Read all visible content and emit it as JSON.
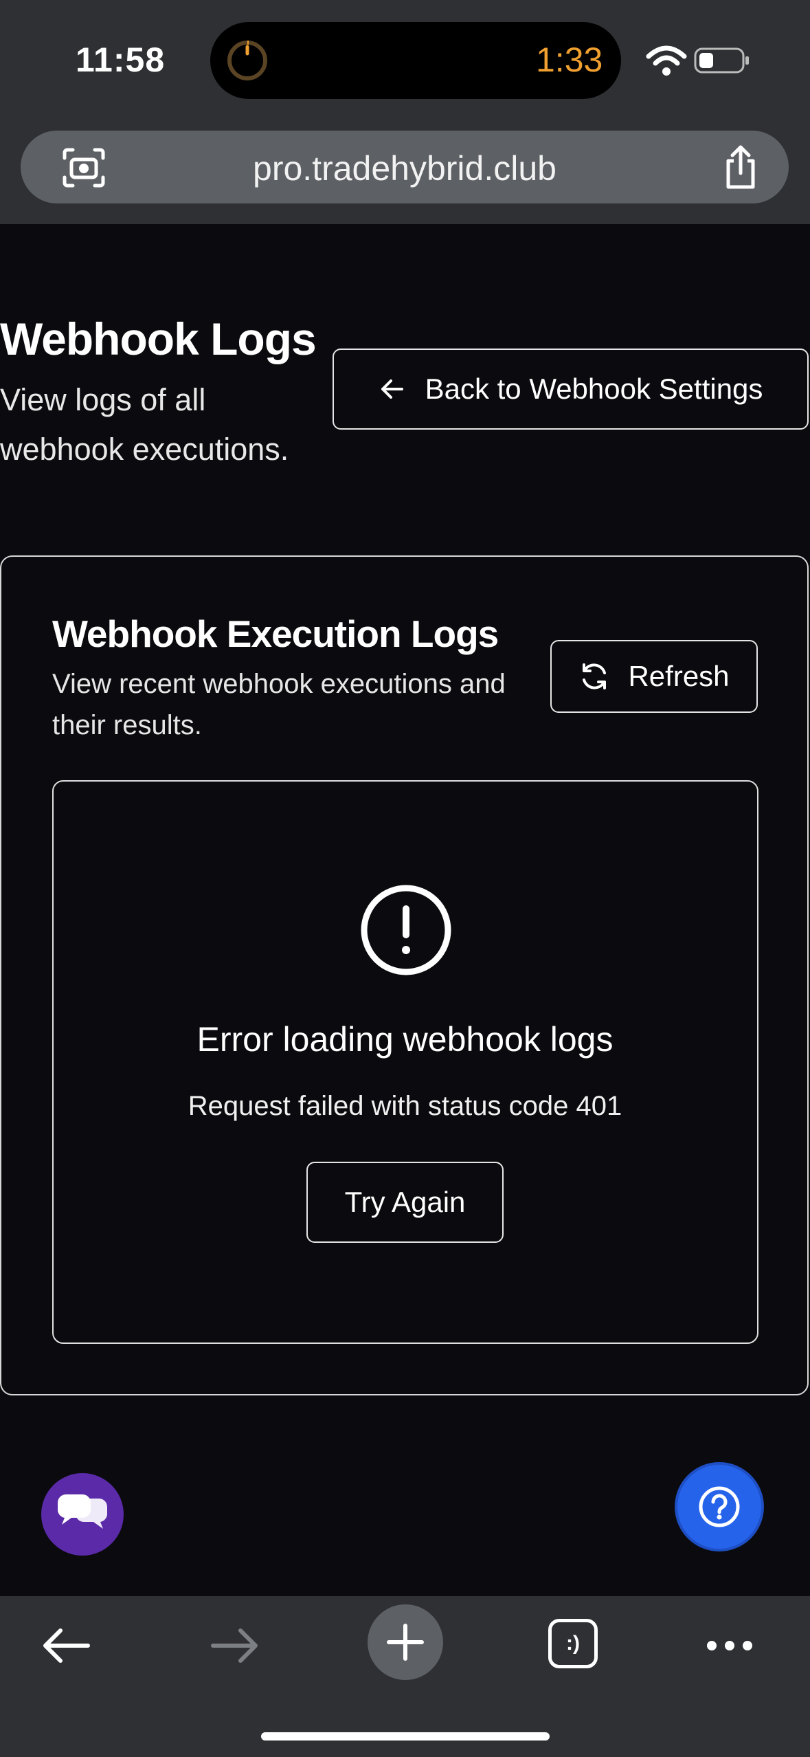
{
  "status_bar": {
    "time": "11:58",
    "timer": "1:33"
  },
  "browser": {
    "url": "pro.tradehybrid.club"
  },
  "page": {
    "title": "Webhook Logs",
    "subtitle": "View logs of all webhook executions.",
    "back_button": "Back to Webhook Settings"
  },
  "card": {
    "title": "Webhook Execution Logs",
    "subtitle": "View recent webhook executions and their results.",
    "refresh_button": "Refresh"
  },
  "error": {
    "title": "Error loading webhook logs",
    "message": "Request failed with status code 401",
    "retry_button": "Try Again"
  },
  "bottom_bar": {
    "tabs_label": ":)"
  },
  "colors": {
    "background": "#0b0b0f",
    "chrome": "#2e3033",
    "timer": "#f0a030",
    "chat_fab": "#5a2aa8",
    "help_fab": "#2563eb"
  },
  "icons": [
    "camera-search-icon",
    "share-icon",
    "wifi-icon",
    "battery-icon",
    "timer-ring-icon",
    "arrow-left-icon",
    "refresh-icon",
    "alert-circle-icon",
    "chat-bubbles-icon",
    "help-circle-icon",
    "back-arrow-icon",
    "forward-arrow-icon",
    "plus-icon",
    "tabs-icon",
    "more-dots-icon"
  ]
}
